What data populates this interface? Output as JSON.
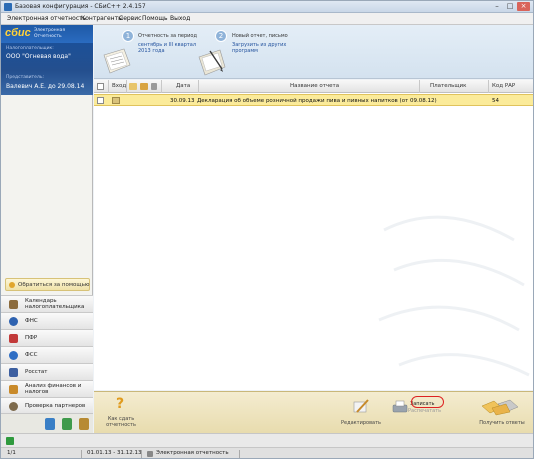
{
  "window": {
    "title": "Базовая конфигурация - СБиС++ 2.4.157"
  },
  "menu": [
    "Электронная отчетность",
    "Контрагенты",
    "Сервис",
    "Помощь",
    "Выход"
  ],
  "sidebar": {
    "logo": "сбис",
    "logo_sub_1": "Электронная",
    "logo_sub_2": "Отчетность",
    "taxpayer_label": "Налогоплательщик:",
    "taxpayer_name": "ООО \"Огневая вода\"",
    "representative_label": "Представитель:",
    "representative_name": "Валевич А.Е. до 29.08.14",
    "contact_button": "Обратиться за помощью",
    "nav": [
      "Календарь налогоплательщика",
      "ФНС",
      "ПФР",
      "ФСС",
      "Росстат",
      "Анализ финансов и налогов",
      "Проверка партнеров"
    ]
  },
  "steps": {
    "step1_num": "1",
    "step1_title": "Отчетность за период",
    "step1_link_1": "сентябрь и III квартал",
    "step1_link_2": "2013 года",
    "step2_num": "2",
    "step2_title": "Новый отчет, письмо",
    "step2_link_1": "Загрузить из других",
    "step2_link_2": "программ"
  },
  "table": {
    "headers": {
      "incoming": "Вход",
      "date": "Дата",
      "name": "Название отчета",
      "payers": "Плательщик",
      "code": "Код РАР"
    },
    "rows": [
      {
        "date": "30.09.13",
        "name": "Декларация об объеме розничной продажи пива и пивных напитков (от 09.08.12)",
        "payers": "",
        "code": "54"
      }
    ]
  },
  "toolbar": {
    "howto_1": "Как сдать",
    "howto_2": "отчетность",
    "edit": "Редактировать",
    "write_1": "Записать",
    "write_2": "Распечатать",
    "receive": "Получить ответы"
  },
  "status": {
    "page": "1/1",
    "period": "01.01.13 - 31.12.13",
    "mode": "Электронная отчетность"
  },
  "colors": {
    "accent": "#1f5aa6",
    "row_highlight": "#fbeb9a",
    "highlight_frame": "#dd2222"
  }
}
